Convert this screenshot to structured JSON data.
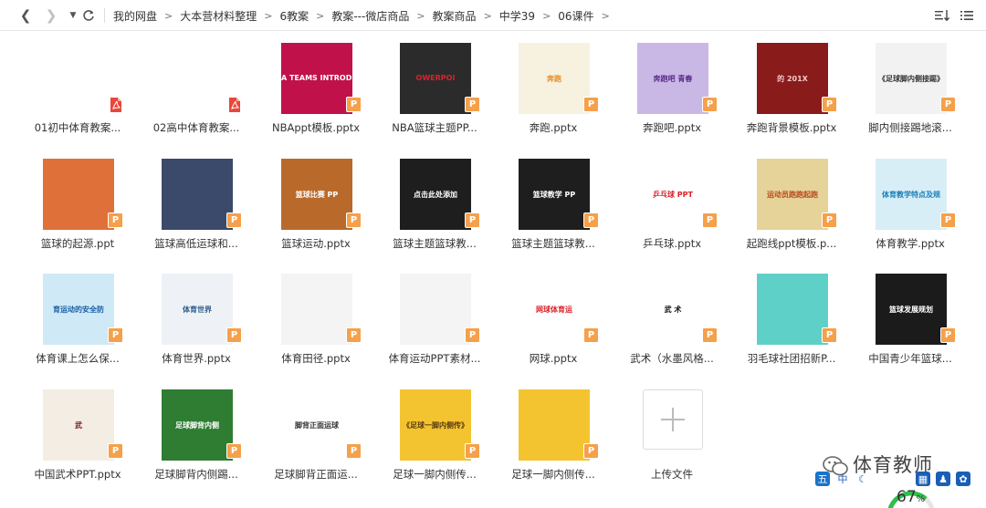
{
  "breadcrumb": [
    "我的网盘",
    "大本营材料整理",
    "6教案",
    "教案---微店商品",
    "教案商品",
    "中学39",
    "06课件"
  ],
  "upload_label": "上传文件",
  "watermark": "体育教师",
  "battery_percent": "67",
  "battery_unit": "%",
  "files": [
    {
      "name": "01初中体育教案...",
      "type": "pdf",
      "thumb": {
        "bg": "#ffffff",
        "caption": ""
      }
    },
    {
      "name": "02高中体育教案...",
      "type": "pdf",
      "thumb": {
        "bg": "#ffffff",
        "caption": ""
      }
    },
    {
      "name": "NBAppt模板.pptx",
      "type": "pptx",
      "thumb": {
        "bg": "#c0114a",
        "caption": "A TEAMS INTRODU",
        "fg": "#ffffff"
      }
    },
    {
      "name": "NBA篮球主题PP...",
      "type": "pptx",
      "thumb": {
        "bg": "#2b2b2b",
        "caption": "OWERPOI",
        "fg": "#d8232a"
      }
    },
    {
      "name": "奔跑.pptx",
      "type": "pptx",
      "thumb": {
        "bg": "#f7f1e0",
        "caption": "奔跑",
        "fg": "#e88b1a"
      }
    },
    {
      "name": "奔跑吧.pptx",
      "type": "pptx",
      "thumb": {
        "bg": "#c9b7e6",
        "caption": "奔跑吧 青春",
        "fg": "#5a2a8a"
      }
    },
    {
      "name": "奔跑背景模板.pptx",
      "type": "pptx",
      "thumb": {
        "bg": "#8a1b1b",
        "caption": "的 201X",
        "fg": "#f2c9c9"
      }
    },
    {
      "name": "脚内侧接踢地滚...",
      "type": "pptx",
      "thumb": {
        "bg": "#f2f2f2",
        "caption": "《足球脚内侧接踢》",
        "fg": "#333333"
      }
    },
    {
      "name": "篮球的起源.ppt",
      "type": "pptx",
      "thumb": {
        "bg": "#e0703a",
        "caption": "",
        "fg": "#ffffff"
      }
    },
    {
      "name": "篮球高低运球和...",
      "type": "pptx",
      "thumb": {
        "bg": "#3b4a6b",
        "caption": "",
        "fg": "#ffffff"
      }
    },
    {
      "name": "篮球运动.pptx",
      "type": "pptx",
      "thumb": {
        "bg": "#b96a2b",
        "caption": "篮球比赛 PP",
        "fg": "#ffffff"
      }
    },
    {
      "name": "篮球主题篮球教...",
      "type": "pptx",
      "thumb": {
        "bg": "#1e1e1e",
        "caption": "点击此处添加",
        "fg": "#ffffff"
      }
    },
    {
      "name": "篮球主题篮球教...",
      "type": "pptx",
      "thumb": {
        "bg": "#1e1e1e",
        "caption": "篮球教学 PP",
        "fg": "#ffffff"
      }
    },
    {
      "name": "乒乓球.pptx",
      "type": "pptx",
      "thumb": {
        "bg": "#ffffff",
        "caption": "乒乓球 PPT",
        "fg": "#d8232a"
      }
    },
    {
      "name": "起跑线ppt模板.p...",
      "type": "pptx",
      "thumb": {
        "bg": "#e6d39a",
        "caption": "运动员跑跑起跑",
        "fg": "#b54a1a"
      }
    },
    {
      "name": "体育教学.pptx",
      "type": "pptx",
      "thumb": {
        "bg": "#d8eef7",
        "caption": "体育教学特点及规",
        "fg": "#1a7fb5"
      }
    },
    {
      "name": "体育课上怎么保...",
      "type": "pptx",
      "thumb": {
        "bg": "#cfe9f7",
        "caption": "育运动的安全防",
        "fg": "#1a5fa5"
      }
    },
    {
      "name": "体育世界.pptx",
      "type": "pptx",
      "thumb": {
        "bg": "#eef2f6",
        "caption": "体育世界",
        "fg": "#2a5a8a"
      }
    },
    {
      "name": "体育田径.pptx",
      "type": "pptx",
      "thumb": {
        "bg": "#f4f4f4",
        "caption": "",
        "fg": "#333333"
      }
    },
    {
      "name": "体育运动PPT素材...",
      "type": "pptx",
      "thumb": {
        "bg": "#f4f4f4",
        "caption": "",
        "fg": "#333333"
      }
    },
    {
      "name": "网球.pptx",
      "type": "pptx",
      "thumb": {
        "bg": "#ffffff",
        "caption": "网球体育运",
        "fg": "#d8232a"
      }
    },
    {
      "name": "武术（水墨风格...",
      "type": "pptx",
      "thumb": {
        "bg": "#ffffff",
        "caption": "武 术",
        "fg": "#111111"
      }
    },
    {
      "name": "羽毛球社团招新P...",
      "type": "pptx",
      "thumb": {
        "bg": "#5fd0c8",
        "caption": "",
        "fg": "#ffffff"
      }
    },
    {
      "name": "中国青少年篮球...",
      "type": "pptx",
      "thumb": {
        "bg": "#1b1b1b",
        "caption": "篮球发展规划",
        "fg": "#ffffff"
      }
    },
    {
      "name": "中国武术PPT.pptx",
      "type": "pptx",
      "thumb": {
        "bg": "#f3ede3",
        "caption": "武",
        "fg": "#7a1a1a"
      }
    },
    {
      "name": "足球脚背内侧踢...",
      "type": "pptx",
      "thumb": {
        "bg": "#2e7d32",
        "caption": "足球脚背内侧",
        "fg": "#ffffff"
      }
    },
    {
      "name": "足球脚背正面运...",
      "type": "pptx",
      "thumb": {
        "bg": "#ffffff",
        "caption": "脚背正面运球",
        "fg": "#333333"
      }
    },
    {
      "name": "足球一脚内侧传...",
      "type": "pptx",
      "thumb": {
        "bg": "#f4c430",
        "caption": "《足球一脚内侧传》",
        "fg": "#5a3a10"
      }
    },
    {
      "name": "足球一脚内侧传...",
      "type": "pptx",
      "thumb": {
        "bg": "#f4c430",
        "caption": "",
        "fg": "#5a3a10"
      }
    }
  ]
}
